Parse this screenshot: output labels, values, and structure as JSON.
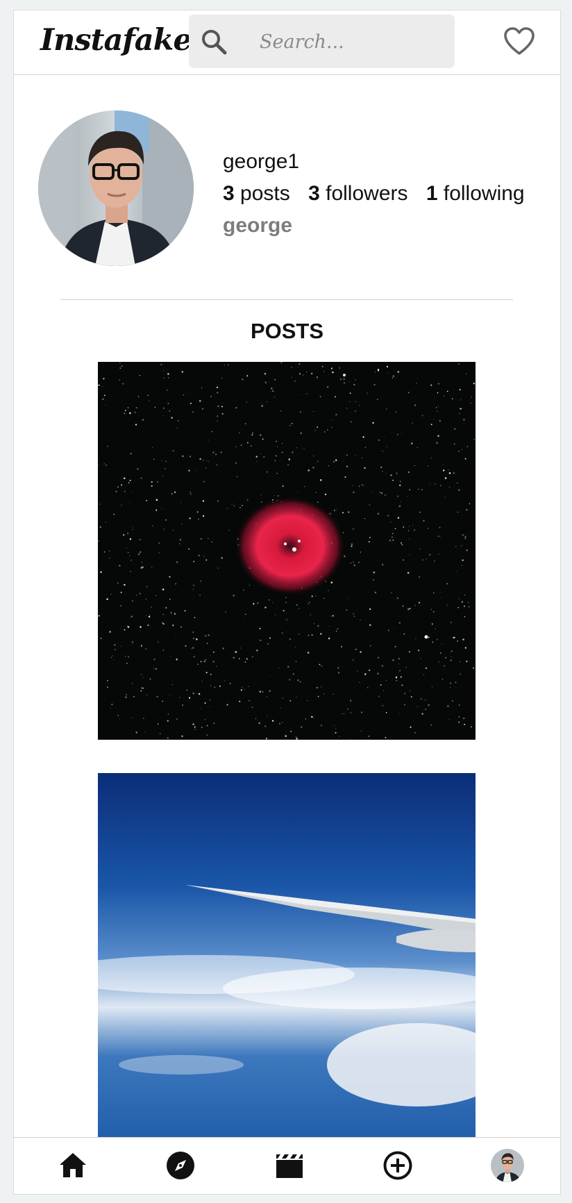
{
  "app": {
    "logo": "Instafake"
  },
  "header": {
    "search_placeholder": "Search...",
    "search_icon": "search-icon",
    "notifications_icon": "heart-icon"
  },
  "profile": {
    "username": "george1",
    "posts_count": "3",
    "posts_label": "posts",
    "followers_count": "3",
    "followers_label": "followers",
    "following_count": "1",
    "following_label": "following",
    "full_name": "george"
  },
  "posts_section": {
    "title": "POSTS"
  },
  "bottom_nav": {
    "items": [
      {
        "icon": "home-icon"
      },
      {
        "icon": "explore-compass-icon"
      },
      {
        "icon": "reels-clapperboard-icon"
      },
      {
        "icon": "create-plus-icon"
      },
      {
        "icon": "profile-avatar"
      }
    ]
  },
  "colors": {
    "accent_text": "#111111",
    "muted_text": "#7d7d7d",
    "search_bg": "#ececec",
    "divider": "#cfcfcf"
  }
}
